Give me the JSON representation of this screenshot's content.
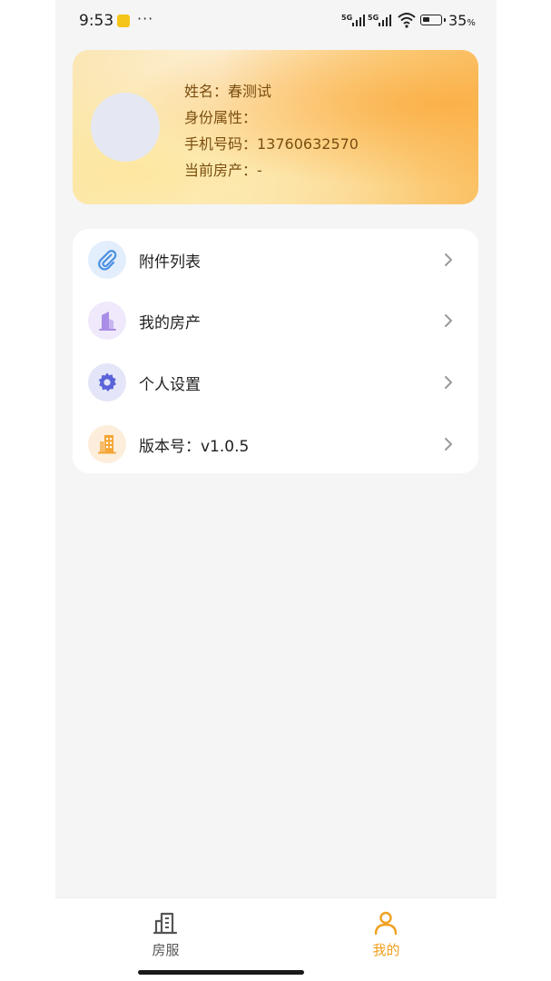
{
  "status_bar": {
    "time": "9:53",
    "dots": "···",
    "net1": "5G",
    "net2": "5G",
    "battery_pct": "35",
    "battery_unit": "%"
  },
  "profile": {
    "name_line": "姓名：春测试",
    "identity_line": "身份属性：",
    "phone_line": "手机号码：13760632570",
    "property_line": "当前房产：-"
  },
  "menu": {
    "items": [
      {
        "label": "附件列表",
        "icon": "paperclip-icon",
        "color": "#4a90e2",
        "bg": "#e3eefc"
      },
      {
        "label": "我的房产",
        "icon": "building-icon",
        "color": "#a98de6",
        "bg": "#efe9fb"
      },
      {
        "label": "个人设置",
        "icon": "gear-icon",
        "color": "#5a63d8",
        "bg": "#e4e5f8"
      },
      {
        "label": "版本号：v1.0.5",
        "icon": "office-icon",
        "color": "#f5a533",
        "bg": "#fdeedb"
      }
    ]
  },
  "tabbar": {
    "tabs": [
      {
        "label": "房服",
        "icon": "building-icon",
        "active": false
      },
      {
        "label": "我的",
        "icon": "user-icon",
        "active": true
      }
    ],
    "active_color": "#f0a020",
    "inactive_color": "#555555"
  }
}
